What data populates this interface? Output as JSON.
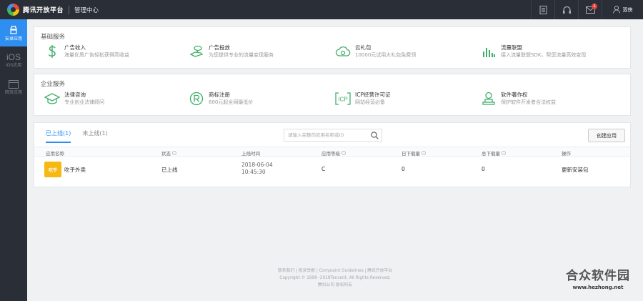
{
  "topbar": {
    "brand": "腾讯开放平台",
    "subtitle": "管理中心",
    "message_count": "1",
    "username": "双侠"
  },
  "sidebar": {
    "items": [
      {
        "label": "安卓应用",
        "icon": "android-icon",
        "active": true
      },
      {
        "label": "iOS应用",
        "icon_text": "iOS",
        "active": false
      },
      {
        "label": "网页应用",
        "icon": "web-icon",
        "active": false
      }
    ]
  },
  "basic_services": {
    "title": "基础服务",
    "items": [
      {
        "name": "广告收入",
        "desc": "海量优质广告轻松获得高收益",
        "icon": "dollar-icon"
      },
      {
        "name": "广告投放",
        "desc": "为您提供专业的流量变现服务",
        "icon": "ad-hand-icon"
      },
      {
        "name": "云礼包",
        "desc": "10000元试用大礼包免费领",
        "icon": "cloud-icon"
      },
      {
        "name": "流量联盟",
        "desc": "接入流量联盟SDK，帮您流量高效变现",
        "icon": "bar-chart-icon"
      }
    ]
  },
  "enterprise_services": {
    "title": "企业服务",
    "items": [
      {
        "name": "法律咨询",
        "desc": "专业创业法律顾问",
        "icon": "graduation-cap-icon"
      },
      {
        "name": "商标注册",
        "desc": "600元起全网最低价",
        "icon": "registered-icon"
      },
      {
        "name": "ICP经营许可证",
        "desc": "网站经营必备",
        "icon": "icp-icon"
      },
      {
        "name": "软件著作权",
        "desc": "保护软件开发者合法权益",
        "icon": "copyright-person-icon"
      }
    ]
  },
  "apps": {
    "tabs": [
      {
        "label": "已上线(1)",
        "active": true
      },
      {
        "label": "未上线(1)",
        "active": false
      }
    ],
    "search_placeholder": "请输入完整的应用名称或ID",
    "create_label": "创建应用",
    "columns": [
      "应用名称",
      "状态",
      "上线时间",
      "应用等级",
      "日下载量",
      "总下载量",
      "操作"
    ],
    "rows": [
      {
        "thumb_text": "吃乎",
        "name": "吃乎外卖",
        "status": "已上线",
        "date": "2018-06-04",
        "time": "10:45:30",
        "level": "C",
        "daily_downloads": "0",
        "total_downloads": "0",
        "action": "更新安装包"
      }
    ]
  },
  "footer": {
    "links": "联系我们 | 投诉举报 | Complaint Guidelines | 腾讯开放平台",
    "copyright": "Copyright © 1998 -2018Tencent. All Rights Reserved.",
    "company": "腾讯公司 版权所有"
  },
  "watermark": {
    "title": "合众软件园",
    "url": "www.hezhong.net"
  },
  "colors": {
    "accent": "#2f8ff0",
    "icon_green": "#3fae6a",
    "topbar": "#2a2e36"
  }
}
